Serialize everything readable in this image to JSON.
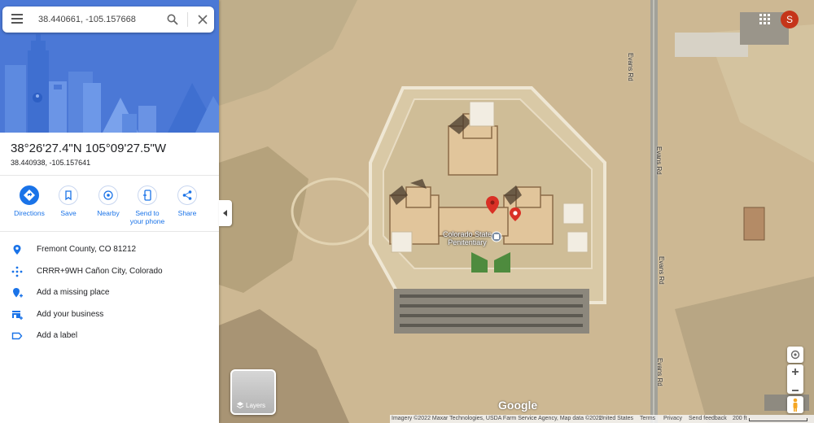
{
  "search": {
    "value": "38.440661, -105.157668"
  },
  "place": {
    "title": "38°26'27.4\"N 105°09'27.5\"W",
    "subtitle": "38.440938, -105.157641"
  },
  "actions": [
    {
      "label": "Directions"
    },
    {
      "label": "Save"
    },
    {
      "label": "Nearby"
    },
    {
      "label": "Send to your phone"
    },
    {
      "label": "Share"
    }
  ],
  "info": [
    {
      "icon": "location-pin-icon",
      "text": "Fremont County, CO 81212"
    },
    {
      "icon": "plus-code-icon",
      "text": "CRRR+9WH Cañon City, Colorado"
    },
    {
      "icon": "add-place-icon",
      "text": "Add a missing place"
    },
    {
      "icon": "business-icon",
      "text": "Add your business"
    },
    {
      "icon": "label-icon",
      "text": "Add a label"
    }
  ],
  "map": {
    "poi_label": "Colorado State Penitentiary",
    "road_label": "Evans Rd",
    "layers_label": "Layers",
    "logo": "Google",
    "account_initial": "S",
    "footer": {
      "imagery": "Imagery ©2022 Maxar Technologies, USDA Farm Service Agency, Map data ©2022",
      "country": "United States",
      "terms": "Terms",
      "privacy": "Privacy",
      "feedback": "Send feedback",
      "scale": "200 ft"
    }
  },
  "colors": {
    "accent": "#1a73e8",
    "pin": "#d93025",
    "hero": "#4b78d6",
    "avatar": "#c5351a"
  }
}
